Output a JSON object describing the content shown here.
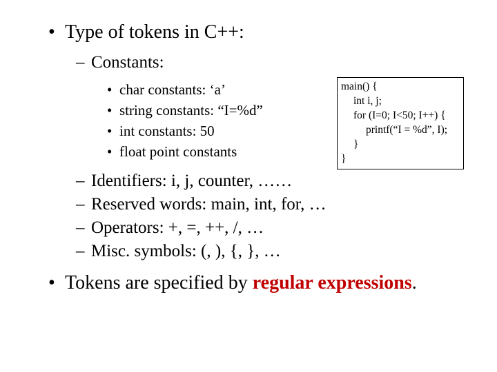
{
  "l1_1": {
    "bullet": "•",
    "text": "Type of tokens in C++:"
  },
  "l2_constants": {
    "dash": "–",
    "text": "Constants:"
  },
  "l3_1": {
    "bullet": "•",
    "text": "char constants: ‘a’"
  },
  "l3_2": {
    "bullet": "•",
    "text": "string constants: “I=%d”"
  },
  "l3_3": {
    "bullet": "•",
    "text": "int constants: 50"
  },
  "l3_4": {
    "bullet": "•",
    "text": "float point constants"
  },
  "l2_identifiers": {
    "dash": "–",
    "text": "Identifiers: i, j, counter, ……"
  },
  "l2_reserved": {
    "dash": "–",
    "text": "Reserved words: main, int, for, …"
  },
  "l2_operators": {
    "dash": "–",
    "text": "Operators: +, =, ++, /, …"
  },
  "l2_misc": {
    "dash": "–",
    "text": "Misc. symbols: (, ), {, }, …"
  },
  "l1_2_a": "Tokens are specified by ",
  "l1_2_b": "regular expressions",
  "l1_2_c": ".",
  "l1_2_bullet": "•",
  "code": {
    "c1": "main() {",
    "c2": "int i, j;",
    "c3": "for (I=0; I<50; I++) {",
    "c4": "printf(“I = %d”, I);",
    "c5": "}",
    "c6": "}"
  }
}
